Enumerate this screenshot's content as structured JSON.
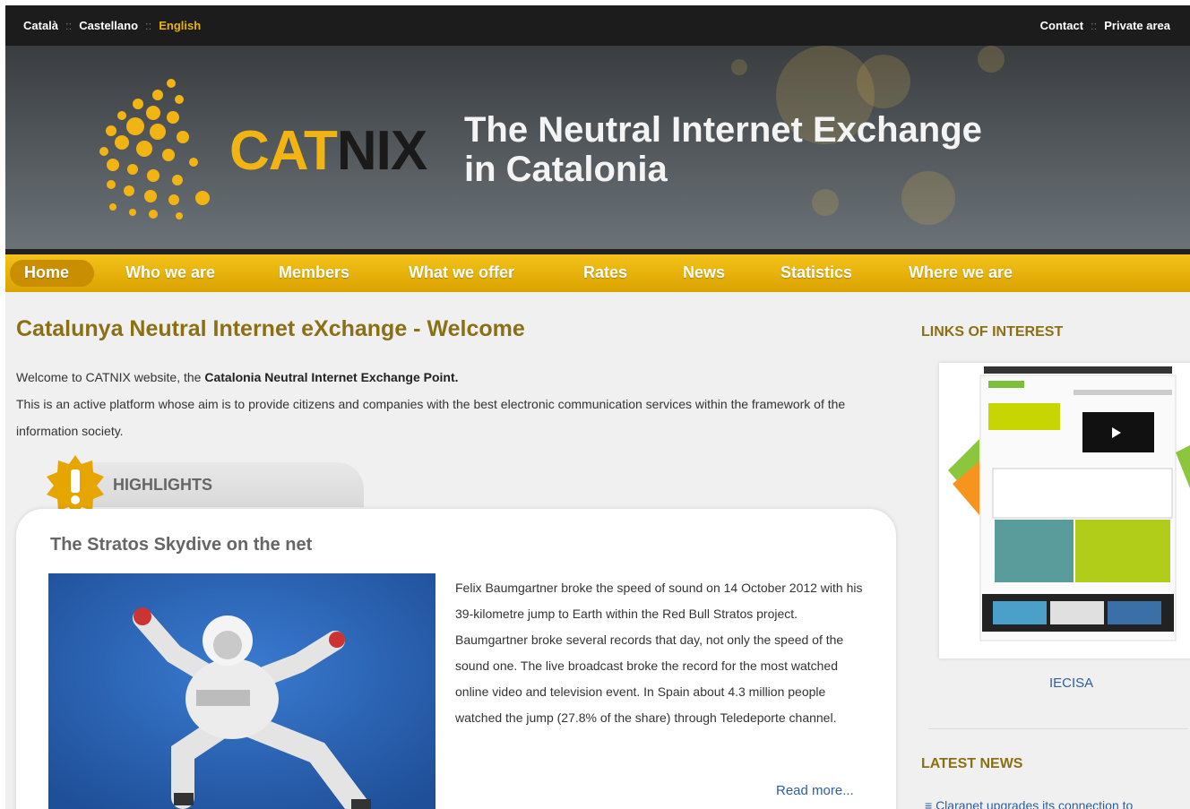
{
  "topbar": {
    "languages": [
      {
        "label": "Català",
        "active": false
      },
      {
        "label": "Castellano",
        "active": false
      },
      {
        "label": "English",
        "active": true
      }
    ],
    "utility_links": [
      "Contact",
      "Private area"
    ]
  },
  "banner": {
    "logo_cat": "CAT",
    "logo_nix": "NIX",
    "tagline_line1": "The Neutral Internet Exchange",
    "tagline_line2": "in Catalonia"
  },
  "nav": {
    "items": [
      "Home",
      "Who we are",
      "Members",
      "What we offer",
      "Rates",
      "News",
      "Statistics",
      "Where we are"
    ],
    "active": "Home"
  },
  "main": {
    "title": "Catalunya Neutral Internet eXchange - Welcome",
    "intro_prefix": "Welcome to CATNIX website, the ",
    "intro_bold": "Catalonia Neutral Internet Exchange Point.",
    "intro_line2": "This is an active platform whose aim is to provide citizens and companies with the best electronic communication services within the framework of the information society."
  },
  "highlights": {
    "label": "HIGHLIGHTS",
    "article_title": "The Stratos Skydive on the net",
    "article_text": "Felix Baumgartner broke the speed of sound on 14 October 2012 with his 39-kilometre jump to Earth within the Red Bull Stratos project. Baumgartner broke several records that day, not only the speed of the sound one. The live broadcast broke the record for the most watched online video and television event. In Spain about 4.3 million people watched the jump (27.8% of the share) through Teledeporte channel.",
    "read_more": "Read more..."
  },
  "sidebar": {
    "links_heading": "LINKS OF INTEREST",
    "link_caption": "IECISA",
    "news_heading": "LATEST NEWS",
    "news_items": [
      "Claranet upgrades its connection to"
    ]
  },
  "colors": {
    "accent_gold": "#f2b413",
    "nav_gold": "#dba300",
    "title_olive": "#8a7014",
    "link_blue": "#2d5fa0"
  }
}
